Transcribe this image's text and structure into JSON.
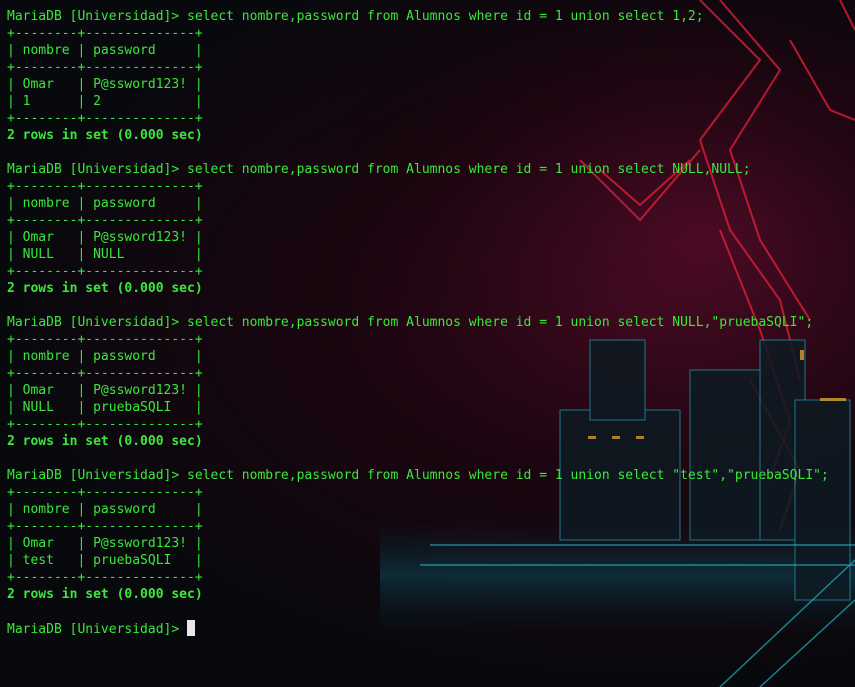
{
  "colors": {
    "text": "#39e83a",
    "background": "#07080c",
    "neon_red": "#e8203a",
    "neon_cyan": "#20d0e0",
    "cursor": "#e8e8e8"
  },
  "blocks": [
    {
      "command": "MariaDB [Universidad]> select nombre,password from Alumnos where id = 1 union select 1,2;",
      "border": "+--------+--------------+",
      "header": "| nombre | password     |",
      "rows": [
        "| Omar   | P@ssword123! |",
        "| 1      | 2            |"
      ],
      "status": "2 rows in set (0.000 sec)"
    },
    {
      "command": "MariaDB [Universidad]> select nombre,password from Alumnos where id = 1 union select NULL,NULL;",
      "border": "+--------+--------------+",
      "header": "| nombre | password     |",
      "rows": [
        "| Omar   | P@ssword123! |",
        "| NULL   | NULL         |"
      ],
      "status": "2 rows in set (0.000 sec)"
    },
    {
      "command": "MariaDB [Universidad]> select nombre,password from Alumnos where id = 1 union select NULL,\"pruebaSQLI\";",
      "border": "+--------+--------------+",
      "header": "| nombre | password     |",
      "rows": [
        "| Omar   | P@ssword123! |",
        "| NULL   | pruebaSQLI   |"
      ],
      "status": "2 rows in set (0.000 sec)"
    },
    {
      "command": "MariaDB [Universidad]> select nombre,password from Alumnos where id = 1 union select \"test\",\"pruebaSQLI\";",
      "border": "+--------+--------------+",
      "header": "| nombre | password     |",
      "rows": [
        "| Omar   | P@ssword123! |",
        "| test   | pruebaSQLI   |"
      ],
      "status": "2 rows in set (0.000 sec)"
    }
  ],
  "prompt": "MariaDB [Universidad]> "
}
